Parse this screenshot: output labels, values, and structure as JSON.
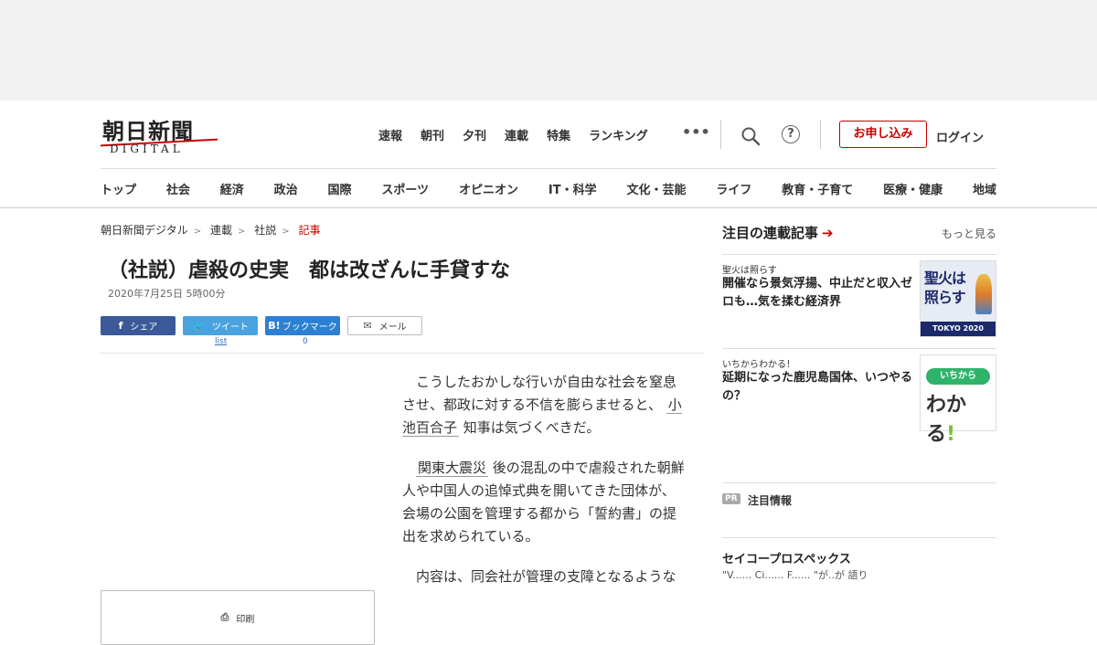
{
  "logo": {
    "jp": "朝日新聞",
    "en": "DIGITAL"
  },
  "topnav": [
    "速報",
    "朝刊",
    "夕刊",
    "連載",
    "特集",
    "ランキング"
  ],
  "header": {
    "more": "•••",
    "apply_label": "お申し込み",
    "login_label": "ログイン",
    "help": "?"
  },
  "catnav": [
    "トップ",
    "社会",
    "経済",
    "政治",
    "国際",
    "スポーツ",
    "オピニオン",
    "IT・科学",
    "文化・芸能",
    "ライフ",
    "教育・子育て",
    "医療・健康",
    "地域"
  ],
  "breadcrumb": [
    "朝日新聞デジタル",
    "連載",
    "社説",
    "記事"
  ],
  "article": {
    "title": "（社説）虐殺の史実　都は改ざんに手貸すな",
    "date": "2020年7月25日 5時00分",
    "p1_pre": "こうしたおかしな行いが自由な社会を窒息させ、都政に対する不信を膨らませると、",
    "p1_link": "小池百合子",
    "p1_post": "知事は気づくべきだ。",
    "p2_link": "関東大震災",
    "p2_post": "後の混乱の中で虐殺された朝鮮人や中国人の追悼式典を開いてきた団体が、会場の公園を管理する都から「誓約書」の提出を求められている。",
    "p3": "内容は、同会社が管理の支障となるような"
  },
  "share": {
    "facebook": "シェア",
    "twitter": "ツイート",
    "hatena": "ブックマーク",
    "mail": "メール",
    "print": "印刷",
    "twitter_count": "list",
    "hatena_count": "0",
    "hatena_icon": "B!"
  },
  "sidebar": {
    "heading": "注目の連載記事",
    "arrow": "➔",
    "more": "もっと見る",
    "cards": [
      {
        "kicker": "聖火は照らす",
        "headline": "開催なら景気浮揚、中止だと収入ゼロも…気を揉む経済界",
        "thumb_text": "聖火は照らす",
        "thumb_sub": "TOKYO 2020"
      },
      {
        "kicker": "いちからわかる！",
        "headline": "延期になった鹿児島国体、いつやるの？",
        "thumb_pill": "いちから",
        "thumb_big": "わかる",
        "thumb_bang": "!"
      }
    ],
    "pr_badge": "PR",
    "pr_label": "注目情報",
    "pr2_label": "セイコープロスペックス",
    "pr2_sub": "\"V...... Ci...... F...... \"が..が 語り"
  },
  "colors": {
    "accent": "#c00000",
    "facebook": "#3b5998",
    "twitter": "#4aa3df",
    "hatena": "#2c80d3"
  }
}
